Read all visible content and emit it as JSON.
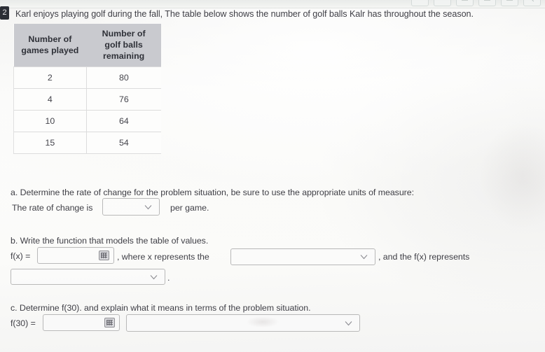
{
  "window": {
    "toolbar_buttons": [
      "",
      "",
      "—",
      "—",
      "—",
      "↖"
    ]
  },
  "question": {
    "number": "2",
    "prompt": "Karl enjoys playing golf during the fall,  The table below shows the number of golf balls Kalr has throughout the season."
  },
  "table": {
    "headers": [
      "Number of games played",
      "Number of golf balls remaining"
    ],
    "header_lines": [
      [
        "Number of",
        "games played"
      ],
      [
        "Number of",
        "golf balls",
        "remaining"
      ]
    ],
    "rows": [
      [
        "2",
        "80"
      ],
      [
        "4",
        "76"
      ],
      [
        "10",
        "64"
      ],
      [
        "15",
        "54"
      ]
    ]
  },
  "part_a": {
    "label": "a. Determine the rate of change for the problem situation, be sure to use the appropriate units of measure:",
    "sentence_before": "The rate of change is",
    "sentence_after": "per game.",
    "rate_select_value": "",
    "rate_select_placeholder": ""
  },
  "part_b": {
    "label": "b. Write the function that models the table of values.",
    "fx_label": "f(x) =",
    "fx_value": "",
    "fx_keyboard_icon": "math-keyboard-icon",
    "mid_text": ", where x represents the",
    "x_select_value": "",
    "after_text": ", and the f(x) represents",
    "fx_select_value": "",
    "trailing_punct": "."
  },
  "part_c": {
    "label": "c. Determine f(30). and explain what it means in terms of the problem situation.",
    "f30_label": "f(30) =",
    "f30_value": "",
    "f30_keyboard_icon": "math-keyboard-icon",
    "explain_select_value": ""
  },
  "colors": {
    "page_bg": "#fbfbf9",
    "table_header_bg": "#c9cacf",
    "text": "#3f3f46",
    "border": "#b9b9b9",
    "badge_bg": "#2c2f36"
  }
}
